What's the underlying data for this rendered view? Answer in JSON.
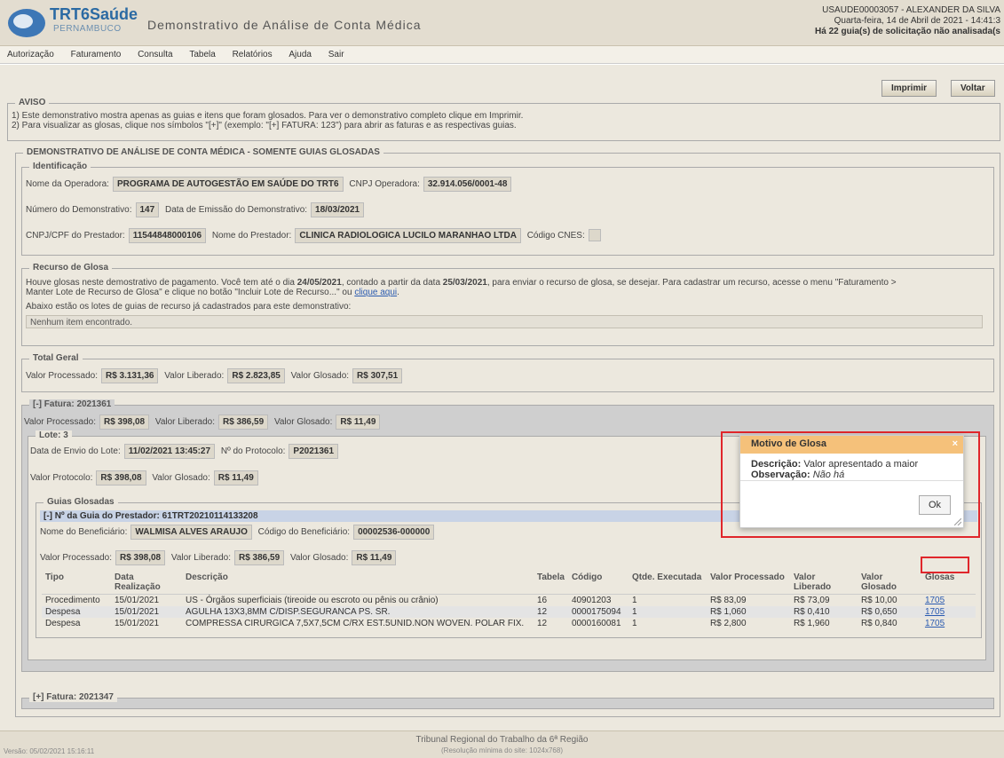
{
  "header": {
    "logo_name": "TRT6Saúde",
    "logo_sub": "PERNAMBUCO",
    "app_title": "Demonstrativo de Análise de Conta Médica",
    "user": "USAUDE00003057 - ALEXANDER DA SILVA",
    "date": "Quarta-feira, 14 de Abril de 2021 - 14:41:3",
    "pending": "Há 22 guia(s) de solicitação não analisada(s"
  },
  "menu": [
    "Autorização",
    "Faturamento",
    "Consulta",
    "Tabela",
    "Relatórios",
    "Ajuda",
    "Sair"
  ],
  "toolbar": {
    "print": "Imprimir",
    "back": "Voltar"
  },
  "aviso": {
    "legend": "AVISO",
    "line1": "1) Este demonstrativo mostra apenas as guias e itens que foram glosados. Para ver o demonstrativo completo clique em Imprimir.",
    "line2": "2) Para visualizar as glosas, clique nos símbolos \"[+]\" (exemplo: \"[+] FATURA: 123\") para abrir as faturas e as respectivas guias."
  },
  "demo": {
    "legend": "DEMONSTRATIVO DE ANÁLISE DE CONTA MÉDICA - SOMENTE GUIAS GLOSADAS",
    "ident_legend": "Identificação",
    "operadora_label": "Nome da Operadora:",
    "operadora": "PROGRAMA DE AUTOGESTÃO EM SAÚDE DO TRT6",
    "cnpj_op_label": "CNPJ Operadora:",
    "cnpj_op": "32.914.056/0001-48",
    "num_label": "Número do Demonstrativo:",
    "num": "147",
    "emissao_label": "Data de Emissão do Demonstrativo:",
    "emissao": "18/03/2021",
    "cnpj_prest_label": "CNPJ/CPF do Prestador:",
    "cnpj_prest": "11544848000106",
    "prestador_label": "Nome do Prestador:",
    "prestador": "CLINICA RADIOLOGICA LUCILO MARANHAO LTDA",
    "cnes_label": "Código CNES:",
    "cnes": ""
  },
  "recurso": {
    "legend": "Recurso de Glosa",
    "text1_a": "Houve glosas neste demostrativo de pagamento. Você tem até o dia ",
    "deadline": "24/05/2021",
    "text1_b": ", contado a partir da data ",
    "from_date": "25/03/2021",
    "text1_c": ", para enviar o recurso de glosa, se desejar. Para cadastrar um recurso, acesse o menu \"Faturamento >",
    "text2": "Manter Lote de Recurso de Glosa\" e clique no botão \"Incluir Lote de Recurso...\" ou ",
    "link": "clique aqui",
    "text2_end": ".",
    "text3": "Abaixo estão os lotes de guias de recurso já cadastrados para este demonstrativo:",
    "empty": "Nenhum item encontrado."
  },
  "total": {
    "legend": "Total Geral",
    "proc_label": "Valor Processado:",
    "proc": "R$ 3.131,36",
    "lib_label": "Valor Liberado:",
    "lib": "R$ 2.823,85",
    "glo_label": "Valor Glosado:",
    "glo": "R$ 307,51"
  },
  "fatura1": {
    "legend": "[-] Fatura: 2021361",
    "proc_label": "Valor Processado:",
    "proc": "R$ 398,08",
    "lib_label": "Valor Liberado:",
    "lib": "R$ 386,59",
    "glo_label": "Valor Glosado:",
    "glo": "R$ 11,49"
  },
  "lote": {
    "legend": "Lote: 3",
    "envio_label": "Data de Envio do Lote:",
    "envio": "11/02/2021 13:45:27",
    "prot_label": "Nº do Protocolo:",
    "prot": "P2021361",
    "vprot_label": "Valor Protocolo:",
    "vprot": "R$ 398,08",
    "glo_label": "Valor Glosado:",
    "glo": "R$ 11,49"
  },
  "guias": {
    "legend": "Guias Glosadas",
    "guia_header": "[-] Nº da Guia do Prestador: 61TRT20210114133208",
    "benef_label": "Nome do Beneficiário:",
    "benef": "WALMISA ALVES ARAUJO",
    "cod_label": "Código do Beneficiário:",
    "cod": "00002536-000000",
    "proc_label": "Valor Processado:",
    "proc": "R$ 398,08",
    "lib_label": "Valor Liberado:",
    "lib": "R$ 386,59",
    "glo_label": "Valor Glosado:",
    "glo": "R$ 11,49"
  },
  "table": {
    "headers": [
      "Tipo",
      "Data Realização",
      "Descrição",
      "Tabela",
      "Código",
      "Qtde. Executada",
      "Valor Processado",
      "Valor Liberado",
      "Valor Glosado",
      "Glosas"
    ],
    "rows": [
      [
        "Procedimento",
        "15/01/2021",
        "US - Órgãos superficiais (tireoide ou escroto ou pênis ou crânio)",
        "16",
        "40901203",
        "1",
        "R$ 83,09",
        "R$ 73,09",
        "R$ 10,00",
        "1705"
      ],
      [
        "Despesa",
        "15/01/2021",
        "AGULHA 13X3,8MM C/DISP.SEGURANCA PS. SR.",
        "12",
        "0000175094",
        "1",
        "R$ 1,060",
        "R$ 0,410",
        "R$ 0,650",
        "1705"
      ],
      [
        "Despesa",
        "15/01/2021",
        "COMPRESSA CIRURGICA 7,5X7,5CM C/RX EST.5UNID.NON WOVEN. POLAR FIX.",
        "12",
        "0000160081",
        "1",
        "R$ 2,800",
        "R$ 1,960",
        "R$ 0,840",
        "1705"
      ]
    ]
  },
  "fatura2": {
    "legend": "[+] Fatura: 2021347"
  },
  "dialog": {
    "title": "Motivo de Glosa",
    "close": "×",
    "desc_label": "Descrição:",
    "desc": "Valor apresentado a maior",
    "obs_label": "Observação:",
    "obs": "Não há",
    "ok": "Ok"
  },
  "footer": {
    "org": "Tribunal Regional do Trabalho da 6ª Região",
    "res": "(Resolução mínima do site: 1024x768)",
    "version": "Versão: 05/02/2021 15:16:11"
  }
}
